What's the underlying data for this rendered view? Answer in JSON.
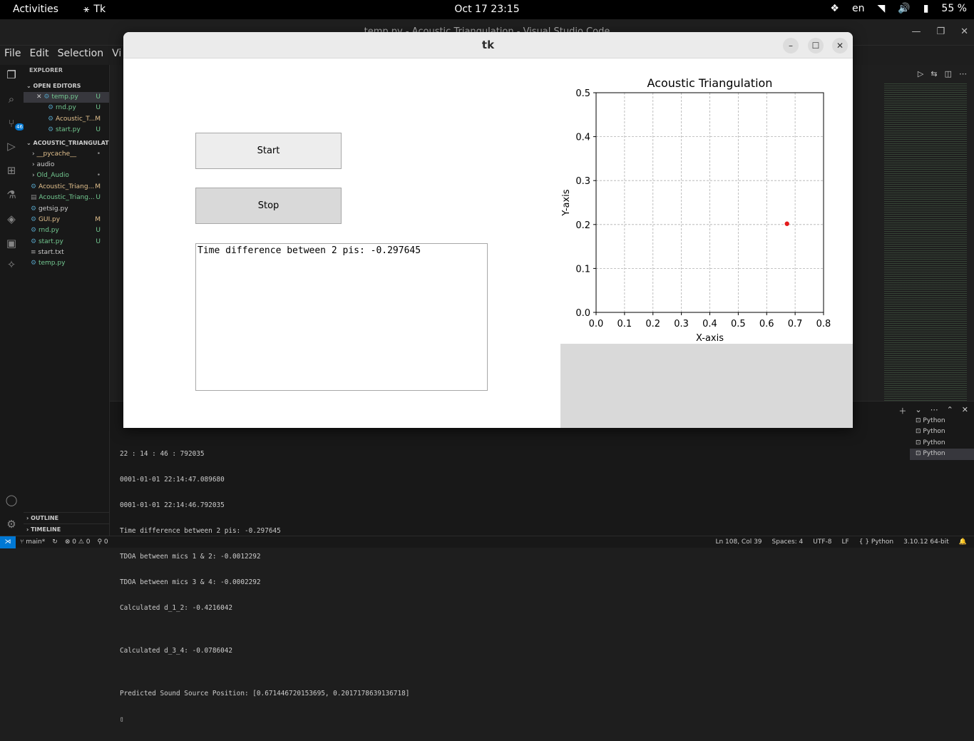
{
  "topbar": {
    "activities": "Activities",
    "app_name": "Tk",
    "clock": "Oct 17  23:15",
    "keyboard": "en",
    "battery": "55 %"
  },
  "vscode": {
    "title": "temp.py - Acoustic Triangulation - Visual Studio Code",
    "menu": [
      "File",
      "Edit",
      "Selection",
      "Vi"
    ],
    "activity_badge": "46",
    "explorer_title": "EXPLORER",
    "open_editors_title": "OPEN EDITORS",
    "open_editors": [
      {
        "name": "temp.py",
        "status": "U",
        "color": "#73c991"
      },
      {
        "name": "rnd.py",
        "status": "U",
        "color": "#73c991"
      },
      {
        "name": "Acoustic_T...",
        "status": "M",
        "color": "#e2c08d"
      },
      {
        "name": "start.py",
        "status": "U",
        "color": "#73c991"
      }
    ],
    "project_title": "ACOUSTIC_TRIANGULATION",
    "files": [
      {
        "name": "__pycache__",
        "status": "•",
        "kind": "folder",
        "color": "#e2c08d"
      },
      {
        "name": "audio",
        "status": "",
        "kind": "folder",
        "color": "#cccccc"
      },
      {
        "name": "Old_Audio",
        "status": "•",
        "kind": "folder",
        "color": "#73c991"
      },
      {
        "name": "Acoustic_Triang...",
        "status": "M",
        "kind": "file",
        "color": "#e2c08d"
      },
      {
        "name": "Acoustic_Triang...",
        "status": "U",
        "kind": "file",
        "color": "#73c991"
      },
      {
        "name": "getsig.py",
        "status": "",
        "kind": "file",
        "color": "#cccccc"
      },
      {
        "name": "GUI.py",
        "status": "M",
        "kind": "file",
        "color": "#e2c08d"
      },
      {
        "name": "rnd.py",
        "status": "U",
        "kind": "file",
        "color": "#73c991"
      },
      {
        "name": "start.py",
        "status": "U",
        "kind": "file",
        "color": "#73c991"
      },
      {
        "name": "start.txt",
        "status": "",
        "kind": "file",
        "color": "#cccccc"
      },
      {
        "name": "temp.py",
        "status": "U",
        "kind": "file",
        "color": "#73c991"
      }
    ],
    "outline_title": "OUTLINE",
    "timeline_title": "TIMELINE",
    "terminal_lines": [
      "22 : 14 : 46 : 792035",
      "0001-01-01 22:14:47.089680",
      "0001-01-01 22:14:46.792035",
      "Time difference between 2 pis: -0.297645",
      "TDOA between mics 1 & 2: -0.0012292",
      "TDOA between mics 3 & 4: -0.0002292",
      "Calculated d_1_2: -0.4216042",
      "",
      "Calculated d_3_4: -0.0786042",
      "",
      "Predicted Sound Source Position: [0.671446720153695, 0.2017178639136718]",
      "▯"
    ],
    "terminal_tabs": [
      "Python",
      "Python",
      "Python",
      "Python"
    ],
    "status": {
      "branch": "main*",
      "problems": "⊗ 0 ⚠ 0",
      "ports": "⚲ 0",
      "position": "Ln 108, Col 39",
      "spaces": "Spaces: 4",
      "encoding": "UTF-8",
      "eol": "LF",
      "language": "Python",
      "interpreter": "3.10.12 64-bit"
    }
  },
  "tk": {
    "title": "tk",
    "start_label": "Start",
    "stop_label": "Stop",
    "text_content": "Time difference between 2 pis: -0.297645"
  },
  "chart_data": {
    "type": "scatter",
    "title": "Acoustic Triangulation",
    "xlabel": "X-axis",
    "ylabel": "Y-axis",
    "xlim": [
      0,
      0.8
    ],
    "ylim": [
      0,
      0.5
    ],
    "xticks": [
      "0.0",
      "0.1",
      "0.2",
      "0.3",
      "0.4",
      "0.5",
      "0.6",
      "0.7",
      "0.8"
    ],
    "yticks": [
      "0.0",
      "0.1",
      "0.2",
      "0.3",
      "0.4",
      "0.5"
    ],
    "grid": true,
    "points": [
      {
        "x": 0.6714,
        "y": 0.2017,
        "color": "#e41a1c"
      }
    ]
  }
}
